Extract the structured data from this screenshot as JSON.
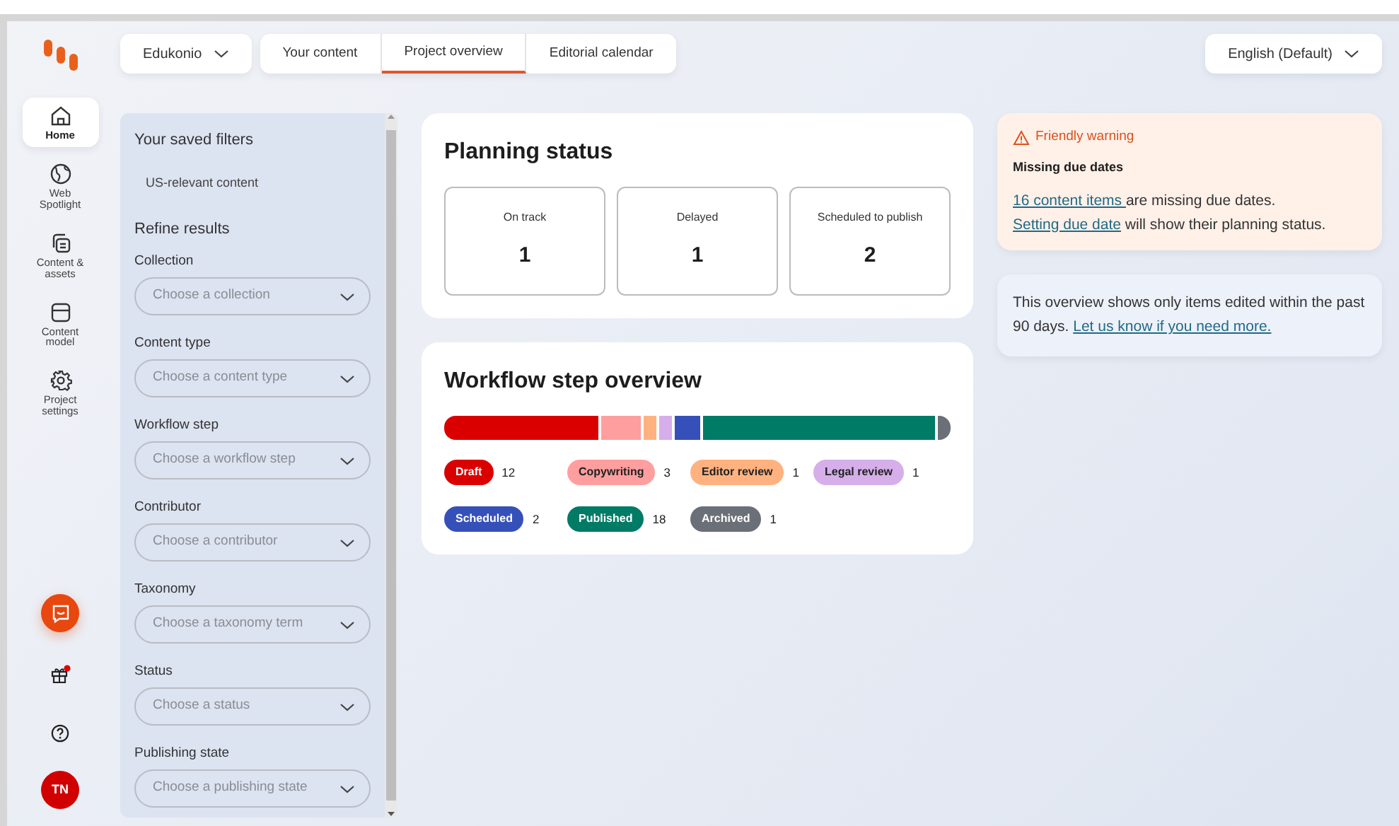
{
  "project": {
    "label": "Edukonio"
  },
  "tabs": [
    {
      "label": "Your content",
      "selected": false
    },
    {
      "label": "Project overview",
      "selected": true
    },
    {
      "label": "Editorial calendar",
      "selected": false
    }
  ],
  "language": {
    "label": "English (Default)"
  },
  "nav": [
    {
      "label": "Home",
      "selected": true
    },
    {
      "label": "Web Spotlight",
      "selected": false
    },
    {
      "label": "Content & assets",
      "selected": false
    },
    {
      "label": "Content model",
      "selected": false
    },
    {
      "label": "Project settings",
      "selected": false
    }
  ],
  "nav_bottom": {
    "gift_has_notification": true,
    "avatar": "TN"
  },
  "filters": {
    "saved_title": "Your saved filters",
    "saved": [
      "US-relevant content"
    ],
    "refine_title": "Refine results",
    "fields": [
      {
        "label": "Collection",
        "placeholder": "Choose a collection"
      },
      {
        "label": "Content type",
        "placeholder": "Choose a content type"
      },
      {
        "label": "Workflow step",
        "placeholder": "Choose a workflow step"
      },
      {
        "label": "Contributor",
        "placeholder": "Choose a contributor"
      },
      {
        "label": "Taxonomy",
        "placeholder": "Choose a taxonomy term"
      },
      {
        "label": "Status",
        "placeholder": "Choose a status"
      },
      {
        "label": "Publishing state",
        "placeholder": "Choose a publishing state"
      }
    ]
  },
  "planning": {
    "title": "Planning status",
    "stats": [
      {
        "label": "On track",
        "value": "1"
      },
      {
        "label": "Delayed",
        "value": "1"
      },
      {
        "label": "Scheduled to publish",
        "value": "2"
      }
    ]
  },
  "workflow": {
    "title": "Workflow step overview",
    "steps": [
      {
        "label": "Draft",
        "count": "12",
        "color": "#db0000"
      },
      {
        "label": "Copywriting",
        "count": "3",
        "color": "#ff9e9e"
      },
      {
        "label": "Editor review",
        "count": "1",
        "color": "#ffb27f"
      },
      {
        "label": "Legal review",
        "count": "1",
        "color": "#d5aeea"
      },
      {
        "label": "Scheduled",
        "count": "2",
        "color": "#3650b9"
      },
      {
        "label": "Published",
        "count": "18",
        "color": "#007b66"
      },
      {
        "label": "Archived",
        "count": "1",
        "color": "#6b6f78"
      }
    ]
  },
  "warning": {
    "label": "Friendly warning",
    "title": "Missing due dates",
    "message": [
      {
        "text": "16 content items ",
        "link": true
      },
      {
        "text": "are missing due dates. ",
        "link": false
      },
      {
        "text": "Setting due date",
        "link": true
      },
      {
        "text": " will show their planning status.",
        "link": false
      }
    ]
  },
  "info": {
    "message": [
      {
        "text": "This overview shows only items edited within the past 90 days. ",
        "link": false
      },
      {
        "text": "Let us know if you need more.",
        "link": true
      }
    ]
  }
}
